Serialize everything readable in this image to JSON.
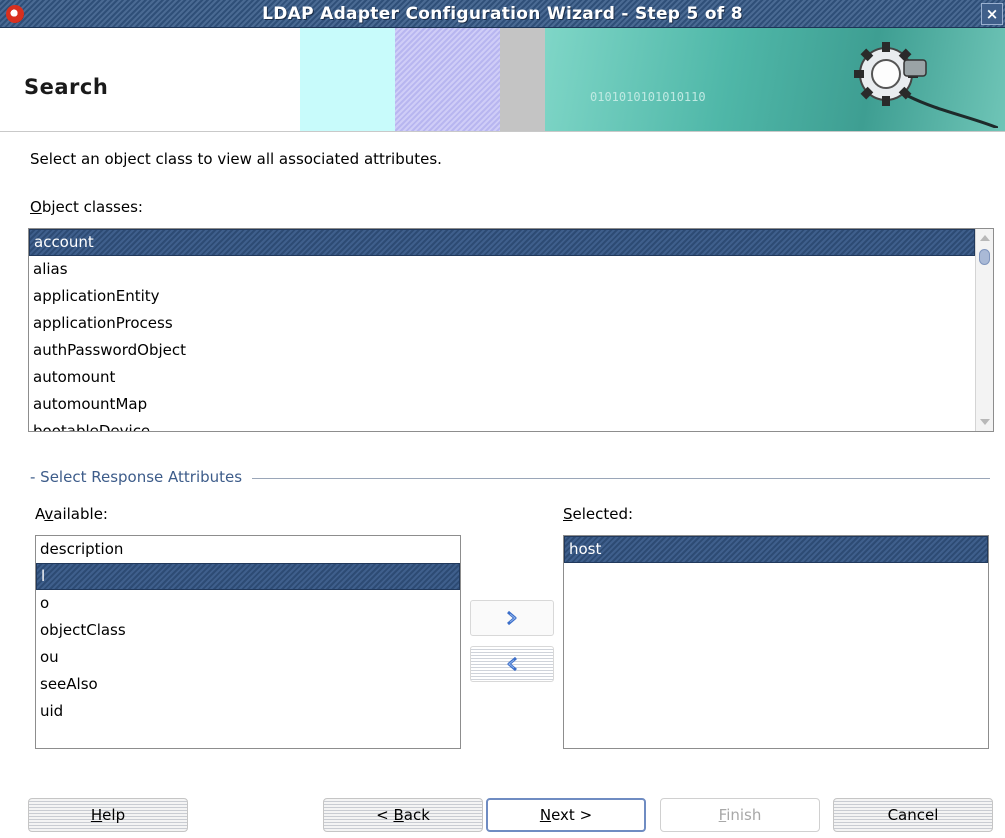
{
  "window": {
    "title": "LDAP Adapter Configuration Wizard - Step 5 of 8",
    "close_glyph": "×"
  },
  "banner": {
    "heading": "Search",
    "art_text": "0101010101010110"
  },
  "instruction": "Select an object class to view all associated attributes.",
  "object_classes": {
    "label_mnemonic": "O",
    "label_rest": "bject classes:",
    "items": [
      "account",
      "alias",
      "applicationEntity",
      "applicationProcess",
      "authPasswordObject",
      "automount",
      "automountMap",
      "bootableDevice"
    ],
    "selected_index": 0
  },
  "response_attributes": {
    "group_title": "- Select Response Attributes",
    "available": {
      "label_pre": "A",
      "label_mnemonic": "v",
      "label_rest": "ailable:",
      "items": [
        "description",
        "l",
        "o",
        "objectClass",
        "ou",
        "seeAlso",
        "uid"
      ],
      "selected_index": 1
    },
    "selected": {
      "label_mnemonic": "S",
      "label_rest": "elected:",
      "items": [
        "host"
      ],
      "selected_index": 0
    }
  },
  "buttons": {
    "help": {
      "mnemonic": "H",
      "rest": "elp"
    },
    "back": {
      "pre": "< ",
      "mnemonic": "B",
      "rest": "ack"
    },
    "next": {
      "mnemonic": "N",
      "rest": "ext >"
    },
    "finish": {
      "mnemonic": "F",
      "rest": "inish"
    },
    "cancel": {
      "label": "Cancel"
    }
  },
  "colors": {
    "selection": "#2d4b74",
    "titlebar": "#3a5a85",
    "group_label": "#3d5c8a",
    "arrow": "#3b6ec9"
  },
  "icons": {
    "move_right": "chevron-right-icon",
    "move_left": "chevron-left-icon",
    "app": "oracle-app-icon",
    "banner": "gear-connector-icon"
  }
}
